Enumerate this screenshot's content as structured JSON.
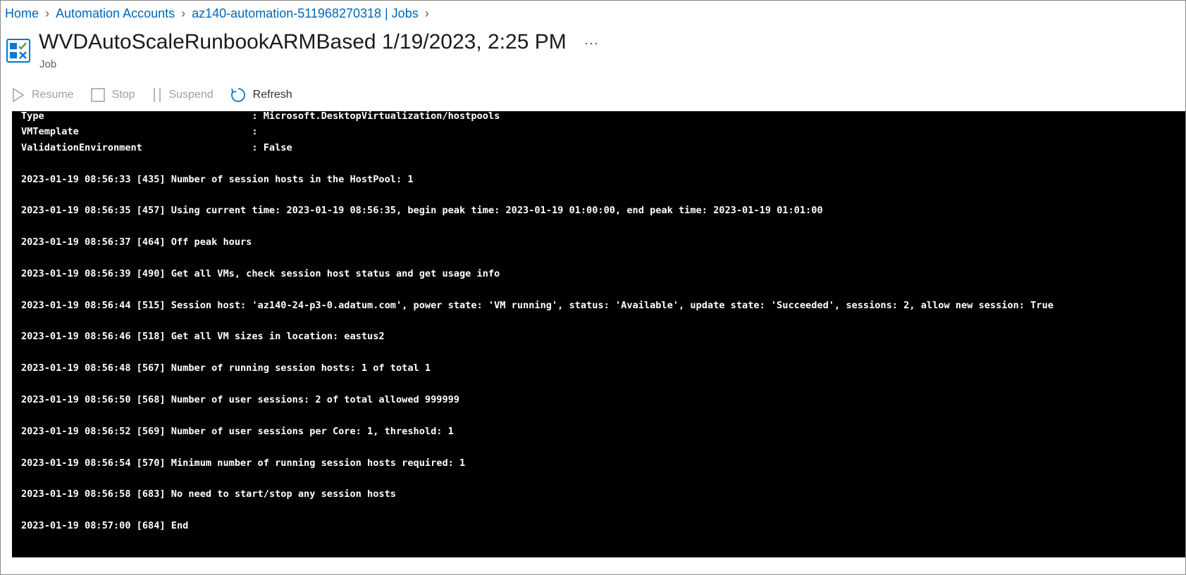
{
  "breadcrumb": {
    "items": [
      "Home",
      "Automation Accounts",
      "az140-automation-511968270318 | Jobs"
    ]
  },
  "header": {
    "title": "WVDAutoScaleRunbookARMBased 1/19/2023, 2:25 PM",
    "subtitle": "Job",
    "more": "···"
  },
  "toolbar": {
    "resume": "Resume",
    "stop": "Stop",
    "suspend": "Suspend",
    "refresh": "Refresh"
  },
  "colors": {
    "link": "#0067b8",
    "console_bg": "#000000",
    "console_text": "#ffffff",
    "disabled": "#a19f9d",
    "icon_blue": "#0078d4"
  },
  "console": {
    "lines": [
      "Type                                    : Microsoft.DesktopVirtualization/hostpools",
      "VMTemplate                              :",
      "ValidationEnvironment                   : False",
      "",
      "2023-01-19 08:56:33 [435] Number of session hosts in the HostPool: 1",
      "",
      "2023-01-19 08:56:35 [457] Using current time: 2023-01-19 08:56:35, begin peak time: 2023-01-19 01:00:00, end peak time: 2023-01-19 01:01:00",
      "",
      "2023-01-19 08:56:37 [464] Off peak hours",
      "",
      "2023-01-19 08:56:39 [490] Get all VMs, check session host status and get usage info",
      "",
      "2023-01-19 08:56:44 [515] Session host: 'az140-24-p3-0.adatum.com', power state: 'VM running', status: 'Available', update state: 'Succeeded', sessions: 2, allow new session: True",
      "",
      "2023-01-19 08:56:46 [518] Get all VM sizes in location: eastus2",
      "",
      "2023-01-19 08:56:48 [567] Number of running session hosts: 1 of total 1",
      "",
      "2023-01-19 08:56:50 [568] Number of user sessions: 2 of total allowed 999999",
      "",
      "2023-01-19 08:56:52 [569] Number of user sessions per Core: 1, threshold: 1",
      "",
      "2023-01-19 08:56:54 [570] Minimum number of running session hosts required: 1",
      "",
      "2023-01-19 08:56:58 [683] No need to start/stop any session hosts",
      "",
      "2023-01-19 08:57:00 [684] End"
    ]
  }
}
